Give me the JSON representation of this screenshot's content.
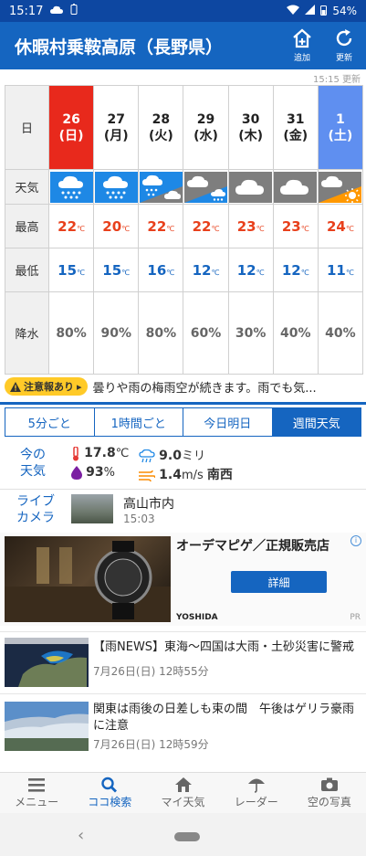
{
  "status": {
    "time": "15:17",
    "battery": "54%"
  },
  "header": {
    "title": "休暇村乗鞍高原（長野県）",
    "add_label": "追加",
    "refresh_label": "更新"
  },
  "updated": "15:15 更新",
  "table": {
    "row_labels": {
      "day": "日",
      "weather": "天気",
      "high": "最高",
      "low": "最低",
      "precip": "降水"
    },
    "days": [
      {
        "date": "26",
        "dow": "(日)",
        "weather": "rain-icon",
        "high": "22",
        "low": "15",
        "precip": "80"
      },
      {
        "date": "27",
        "dow": "(月)",
        "weather": "rain-icon",
        "high": "20",
        "low": "15",
        "precip": "90"
      },
      {
        "date": "28",
        "dow": "(火)",
        "weather": "rain-then-cloud-icon",
        "high": "22",
        "low": "16",
        "precip": "80"
      },
      {
        "date": "29",
        "dow": "(水)",
        "weather": "cloud-then-rain-icon",
        "high": "22",
        "low": "12",
        "precip": "60"
      },
      {
        "date": "30",
        "dow": "(木)",
        "weather": "cloud-icon",
        "high": "23",
        "low": "12",
        "precip": "30"
      },
      {
        "date": "31",
        "dow": "(金)",
        "weather": "cloud-icon",
        "high": "23",
        "low": "12",
        "precip": "40"
      },
      {
        "date": "1",
        "dow": "(土)",
        "weather": "cloud-then-sun-icon",
        "high": "24",
        "low": "11",
        "precip": "40"
      }
    ],
    "temp_unit": "℃",
    "precip_unit": "%"
  },
  "alert": {
    "badge": "注意報あり",
    "text": "曇りや雨の梅雨空が続きます。雨でも気..."
  },
  "tabs": [
    "5分ごと",
    "1時間ごと",
    "今日明日",
    "週間天気"
  ],
  "now": {
    "label_line1": "今の",
    "label_line2": "天気",
    "temp_value": "17.8",
    "temp_unit": "℃",
    "rain_value": "9.0",
    "rain_unit": "ミリ",
    "humidity_value": "93",
    "humidity_unit": "%",
    "wind_value": "1.4",
    "wind_unit": "m/s",
    "wind_dir": "南西"
  },
  "live": {
    "label_line1": "ライブ",
    "label_line2": "カメラ",
    "city": "高山市内",
    "time": "15:03"
  },
  "ad": {
    "title": "オーデマピゲ／正規販売店",
    "button": "詳細",
    "brand": "YOSHIDA",
    "pr": "PR",
    "info": "i"
  },
  "news": [
    {
      "title": "【雨NEWS】東海～四国は大雨・土砂災害に警戒",
      "time": "7月26日(日) 12時55分"
    },
    {
      "title": "関東は雨後の日差しも束の間　午後はゲリラ豪雨に注意",
      "time": "7月26日(日) 12時59分"
    }
  ],
  "bottom_nav": [
    "メニュー",
    "ココ検索",
    "マイ天気",
    "レーダー",
    "空の写真"
  ]
}
